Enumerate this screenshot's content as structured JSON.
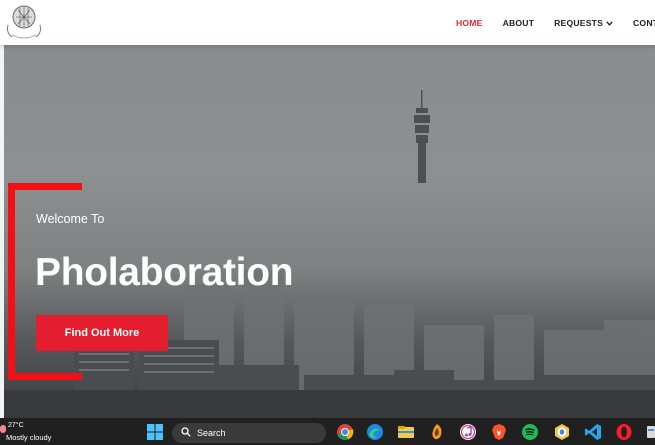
{
  "header": {
    "nav": [
      {
        "label": "HOME",
        "active": true
      },
      {
        "label": "ABOUT",
        "active": false
      },
      {
        "label": "REQUESTS",
        "active": false,
        "dropdown": true
      },
      {
        "label": "CONTA",
        "active": false
      }
    ]
  },
  "hero": {
    "welcome": "Welcome To",
    "title": "Pholaboration",
    "cta_label": "Find Out More",
    "accent_color": "#f40e16"
  },
  "taskbar": {
    "weather_temp": "27°C",
    "weather_condition": "Mostly cloudy",
    "search_label": "Search",
    "apps": [
      "windows-start",
      "chrome",
      "edge",
      "file-explorer",
      "fl-studio",
      "itunes",
      "brave",
      "spotify",
      "app",
      "vscode",
      "opera"
    ]
  }
}
